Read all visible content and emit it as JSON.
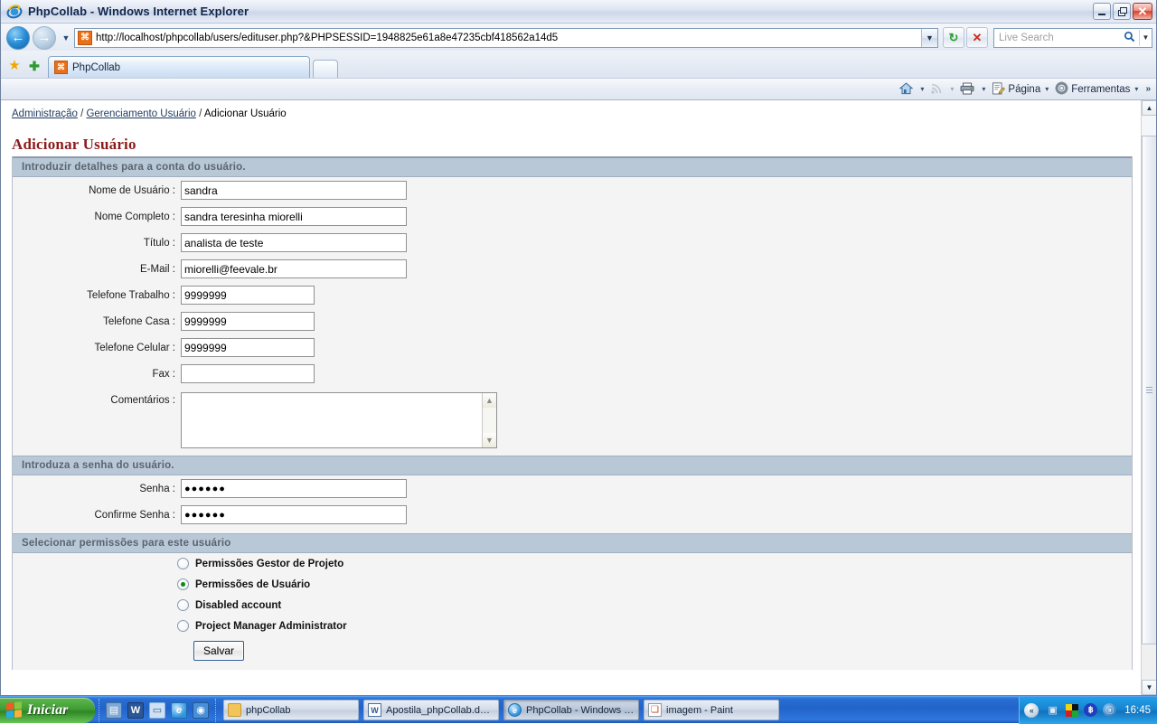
{
  "window": {
    "title": "PhpCollab - Windows Internet Explorer",
    "ie_icon": "internet-explorer-icon",
    "minimize_label": "–",
    "restore_label": "❐",
    "close_label": "✕"
  },
  "browser": {
    "back_label": "←",
    "forward_label": "→",
    "history_dropdown_label": "▼",
    "url": "http://localhost/phpcollab/users/edituser.php?&PHPSESSID=1948825e61a8e47235cbf418562a14d5",
    "favicon_label": "⌘",
    "url_dropdown_label": "▼",
    "refresh_label": "↻",
    "stop_label": "✕",
    "search": {
      "placeholder": "Live Search",
      "go_icon_label": "⚲",
      "dropdown_label": "▼"
    },
    "favorites_star_label": "★",
    "add_favorite_label": "✚",
    "tabs": [
      {
        "label": "PhpCollab",
        "favicon": "phpcollab-favicon"
      }
    ],
    "new_tab_label": "",
    "commands": [
      {
        "label": "",
        "icon": "home-icon",
        "caret": "▾",
        "dim": false
      },
      {
        "label": "",
        "icon": "feeds-icon",
        "caret": "▾",
        "dim": true
      },
      {
        "label": "",
        "icon": "print-icon",
        "caret": "▾",
        "dim": false
      },
      {
        "label": "Página",
        "icon": "page-icon",
        "caret": "▾",
        "dim": false
      },
      {
        "label": "Ferramentas",
        "icon": "tools-gear-icon",
        "caret": "▾",
        "dim": false
      }
    ],
    "overflow_label": "»"
  },
  "page": {
    "breadcrumb": {
      "item1": "Administração",
      "sep1": " / ",
      "item2": "Gerenciamento Usuário",
      "sep2": " / ",
      "item3": "Adicionar Usuário"
    },
    "title": "Adicionar Usuário",
    "sections": {
      "details_header": "Introduzir detalhes para a conta do usuário.",
      "password_header": "Introduza a senha do usuário.",
      "permissions_header": "Selecionar permissões para este usuário"
    },
    "fields": [
      {
        "label": "Nome de Usuário :",
        "value": "sandra"
      },
      {
        "label": "Nome Completo :",
        "value": "sandra teresinha miorelli"
      },
      {
        "label": "Título :",
        "value": "analista de teste"
      },
      {
        "label": "E-Mail :",
        "value": "miorelli@feevale.br"
      },
      {
        "label": "Telefone Trabalho :",
        "value": "9999999"
      },
      {
        "label": "Telefone Casa :",
        "value": "9999999"
      },
      {
        "label": "Telefone Celular :",
        "value": "9999999"
      },
      {
        "label": "Fax :",
        "value": ""
      }
    ],
    "comments": {
      "label": "Comentários :",
      "value": "",
      "scroll_up": "▲",
      "scroll_down": "▼"
    },
    "password_fields": [
      {
        "label": "Senha :",
        "value": "●●●●●●"
      },
      {
        "label": "Confirme Senha :",
        "value": "●●●●●●"
      }
    ],
    "permissions": [
      {
        "label": "Permissões Gestor de Projeto",
        "selected": false
      },
      {
        "label": "Permissões de Usuário",
        "selected": true
      },
      {
        "label": "Disabled account",
        "selected": false
      },
      {
        "label": "Project Manager Administrator",
        "selected": false
      }
    ],
    "save_button": "Salvar",
    "colors": {
      "section_header_bg": "#b9c8d6",
      "section_header_text": "#5a6470",
      "title_text": "#8c1b1b",
      "form_bg": "#f4f4f4",
      "radio_selected": "#108a10"
    }
  },
  "scrollbar": {
    "up_label": "▲",
    "down_label": "▼"
  },
  "taskbar": {
    "start_label": "Iniciar",
    "quicklaunch": [
      {
        "name": "show-desktop-icon",
        "glyph": "▤"
      },
      {
        "name": "word-icon",
        "glyph": "W"
      },
      {
        "name": "notepad-icon",
        "glyph": "▭"
      },
      {
        "name": "internet-explorer-icon",
        "glyph": "e"
      },
      {
        "name": "media-icon",
        "glyph": "◉"
      }
    ],
    "tasks": [
      {
        "label": "phpCollab",
        "icon": "folder-icon",
        "active": false
      },
      {
        "label": "Apostila_phpCollab.d…",
        "icon": "word-doc-icon",
        "active": false
      },
      {
        "label": "PhpCollab - Windows …",
        "icon": "internet-explorer-icon",
        "active": true
      },
      {
        "label": "imagem - Paint",
        "icon": "paint-icon",
        "active": false
      }
    ],
    "tray": {
      "expand_label": "«",
      "icons": [
        {
          "name": "network-icon",
          "glyph": "▣"
        },
        {
          "name": "display-colors-icon",
          "glyph": "■"
        },
        {
          "name": "bluetooth-icon",
          "glyph": "฿"
        },
        {
          "name": "antivirus-icon",
          "glyph": "ⓐ"
        }
      ],
      "clock": "16:45"
    }
  }
}
